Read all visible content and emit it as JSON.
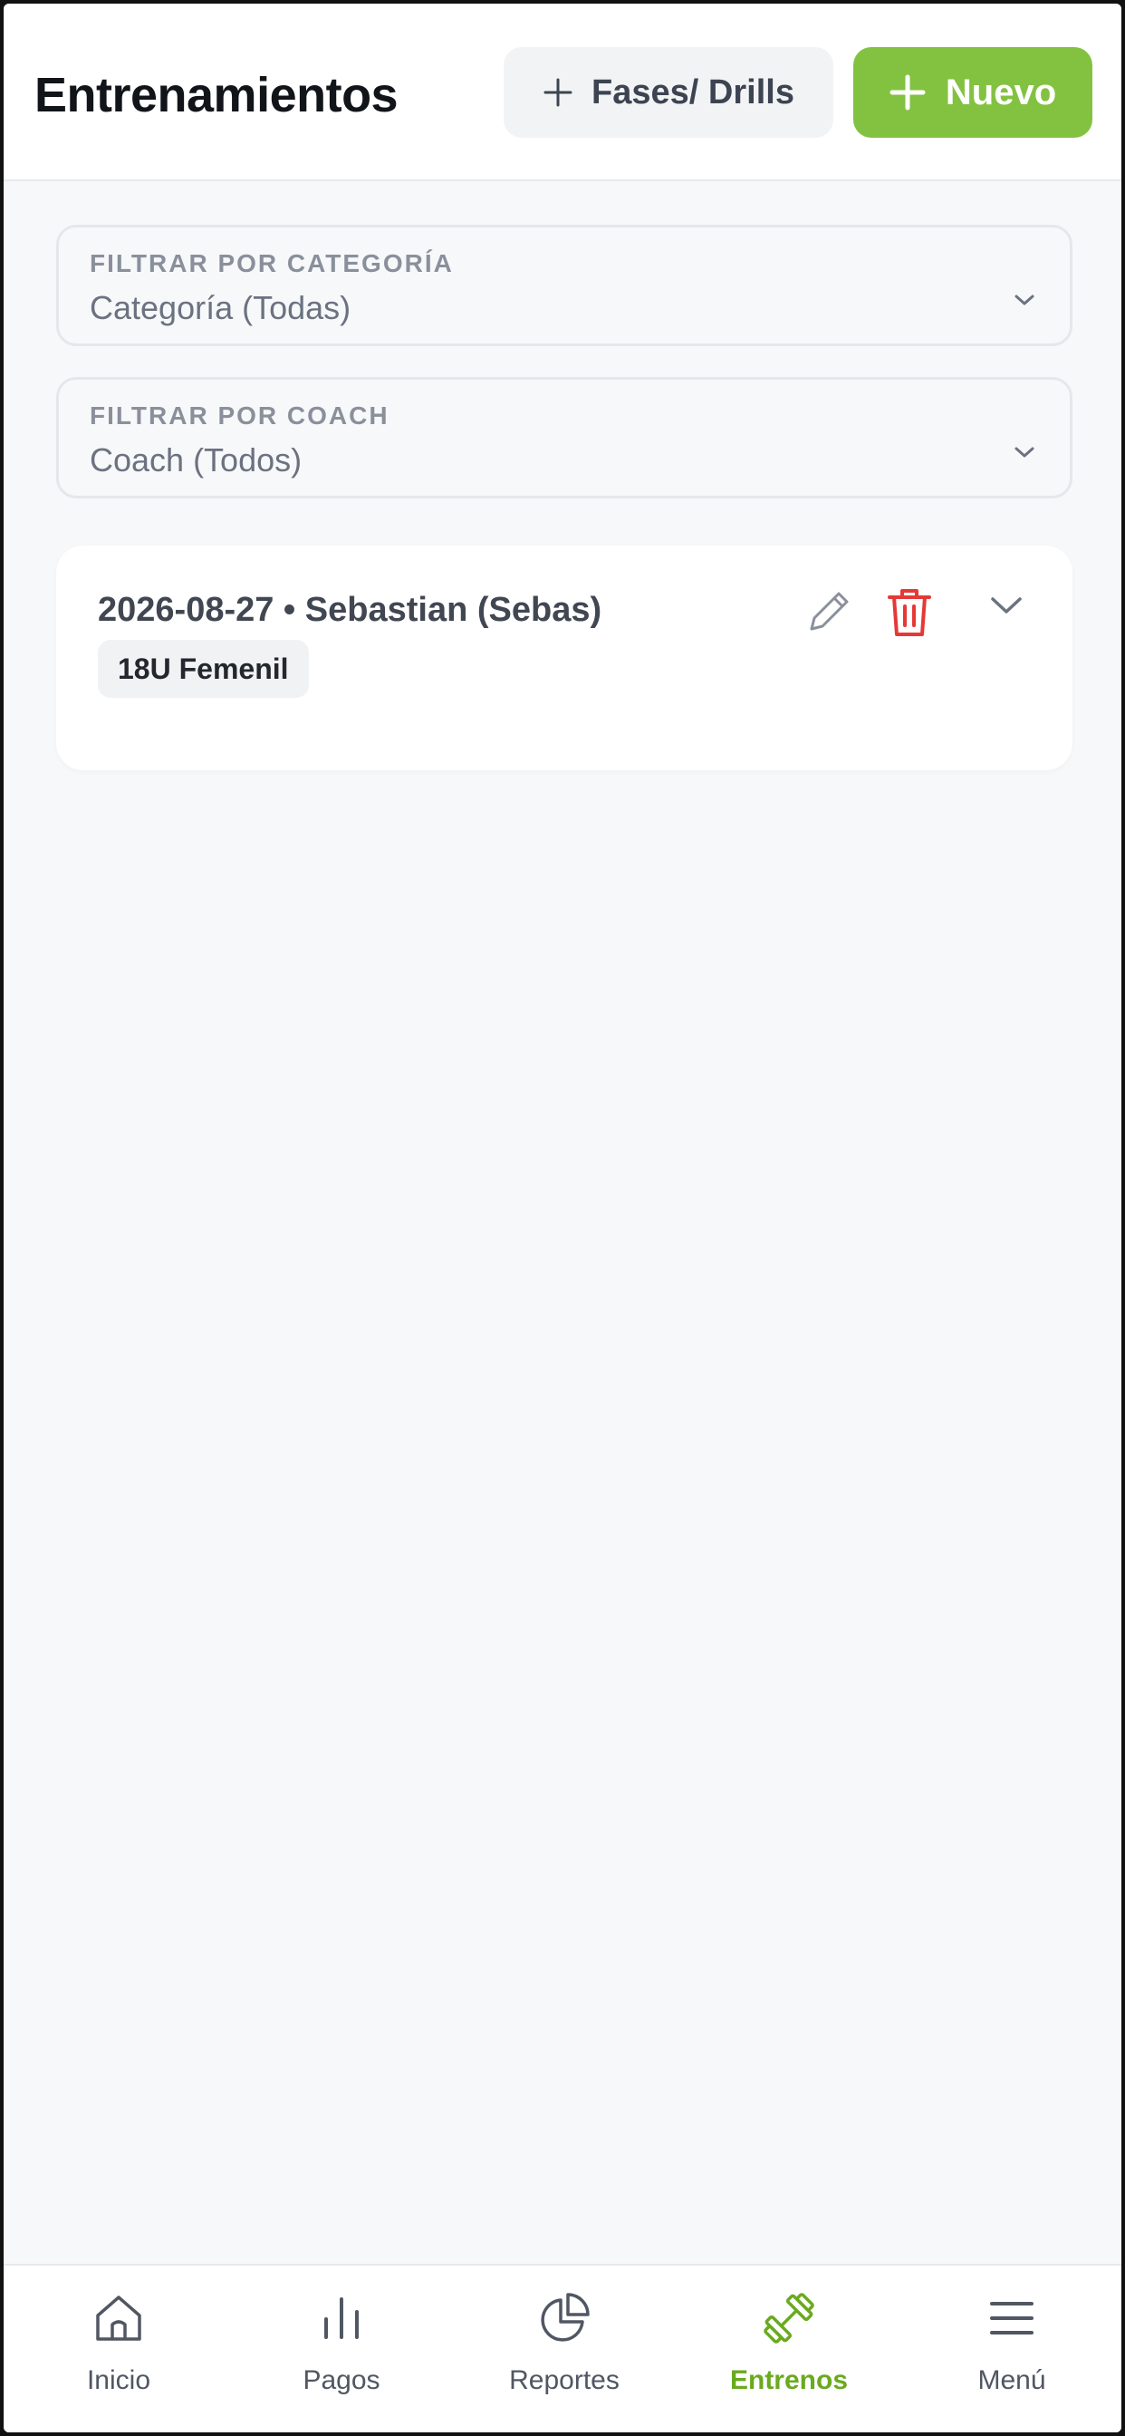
{
  "header": {
    "title": "Entrenamientos",
    "phases_button_label": "Fases/ Drills",
    "new_button_label": "Nuevo"
  },
  "filters": {
    "category": {
      "label": "FILTRAR POR CATEGORÍA",
      "value": "Categoría (Todas)"
    },
    "coach": {
      "label": "FILTRAR POR COACH",
      "value": "Coach (Todos)"
    }
  },
  "trainings": [
    {
      "title": "2026-08-27 • Sebastian (Sebas)",
      "category_tag": "18U Femenil"
    }
  ],
  "bottom_nav": {
    "items": [
      {
        "label": "Inicio",
        "icon": "home-icon",
        "active": false
      },
      {
        "label": "Pagos",
        "icon": "bar-chart-icon",
        "active": false
      },
      {
        "label": "Reportes",
        "icon": "pie-chart-icon",
        "active": false
      },
      {
        "label": "Entrenos",
        "icon": "dumbbell-icon",
        "active": true
      },
      {
        "label": "Menú",
        "icon": "menu-icon",
        "active": false
      }
    ]
  },
  "colors": {
    "accent": "#83c241",
    "active_nav": "#6aaa1e",
    "delete": "#e53935",
    "background": "#f7f8fa"
  }
}
